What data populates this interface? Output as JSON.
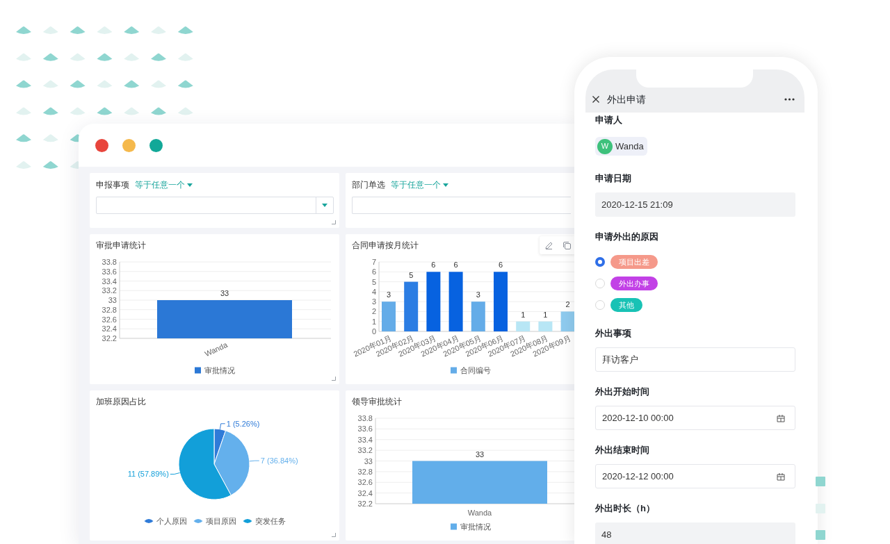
{
  "window": {
    "filters": [
      {
        "label": "申报事项",
        "operator": "等于任意一个"
      },
      {
        "label": "部门单选",
        "operator": "等于任意一个"
      }
    ],
    "charts": [
      {
        "slanted_labels": true,
        "chart_data": {
          "type": "bar",
          "title": "审批申请统计",
          "categories": [
            "Wanda"
          ],
          "series": [
            {
              "name": "审批情况",
              "color": "#2b78d6",
              "values": [
                33
              ]
            }
          ],
          "ylim": [
            32.2,
            33.8
          ],
          "yticks": [
            32.2,
            32.4,
            32.6,
            32.8,
            33,
            33.2,
            33.4,
            33.6,
            33.8
          ],
          "grid": true,
          "legend": "bottom",
          "data_labels": true
        }
      },
      {
        "slanted_labels": true,
        "toolbar_shown": true,
        "chart_data": {
          "type": "bar",
          "title": "合同申请按月统计",
          "categories": [
            "2020年01月",
            "2020年02月",
            "2020年03月",
            "2020年04月",
            "2020年05月",
            "2020年06月",
            "2020年07月",
            "2020年08月",
            "2020年09月"
          ],
          "series": [
            {
              "name": "合同编号",
              "values": [
                3,
                5,
                6,
                6,
                3,
                6,
                1,
                1,
                2
              ]
            }
          ],
          "colors": [
            "#64ace8",
            "#2b7de3",
            "#0762e0",
            "#0762e0",
            "#64ace8",
            "#0762e0",
            "#b8e6f5",
            "#b8e6f5",
            "#8fcbef"
          ],
          "ylim": [
            0,
            7
          ],
          "yticks": [
            0,
            1,
            2,
            3,
            4,
            5,
            6,
            7
          ],
          "grid": true,
          "legend": "bottom",
          "data_labels": true
        }
      },
      {
        "chart_data": {
          "type": "pie",
          "title": "加班原因占比",
          "categories": [
            "个人原因",
            "项目原因",
            "突发任务"
          ],
          "values": [
            1,
            7,
            11
          ],
          "colors": [
            "#2f7bd8",
            "#64b0ec",
            "#129fd9"
          ],
          "value_labels": [
            "1 (5.26%)",
            "7 (36.84%)",
            "11 (57.89%)"
          ],
          "legend": "bottom"
        }
      },
      {
        "slanted_labels": false,
        "chart_data": {
          "type": "bar",
          "title": "领导审批统计",
          "categories": [
            "Wanda"
          ],
          "series": [
            {
              "name": "审批情况",
              "color": "#62aeea",
              "values": [
                33
              ]
            }
          ],
          "ylim": [
            32.2,
            33.8
          ],
          "yticks": [
            32.2,
            32.4,
            32.6,
            32.8,
            33,
            33.2,
            33.4,
            33.6,
            33.8
          ],
          "grid": true,
          "legend": "bottom",
          "data_labels": true
        }
      }
    ]
  },
  "phone": {
    "title": "外出申请",
    "fields": [
      {
        "kind": "person",
        "label": "申请人",
        "avatar": "W",
        "value": "Wanda"
      },
      {
        "kind": "readonly",
        "label": "申请日期",
        "value": "2020-12-15 21:09"
      },
      {
        "kind": "radio",
        "label": "申请外出的原因",
        "options": [
          {
            "text": "项目出差",
            "color": "#f5998a",
            "selected": true
          },
          {
            "text": "外出办事",
            "color": "#c241e6",
            "selected": false
          },
          {
            "text": "其他",
            "color": "#19c2b5",
            "selected": false
          }
        ]
      },
      {
        "kind": "text",
        "label": "外出事项",
        "value": "拜访客户"
      },
      {
        "kind": "date",
        "label": "外出开始时间",
        "value": "2020-12-10 00:00"
      },
      {
        "kind": "date",
        "label": "外出结束时间",
        "value": "2020-12-12 00:00"
      },
      {
        "kind": "readonly",
        "label": "外出时长（h）",
        "value": "48"
      }
    ]
  }
}
